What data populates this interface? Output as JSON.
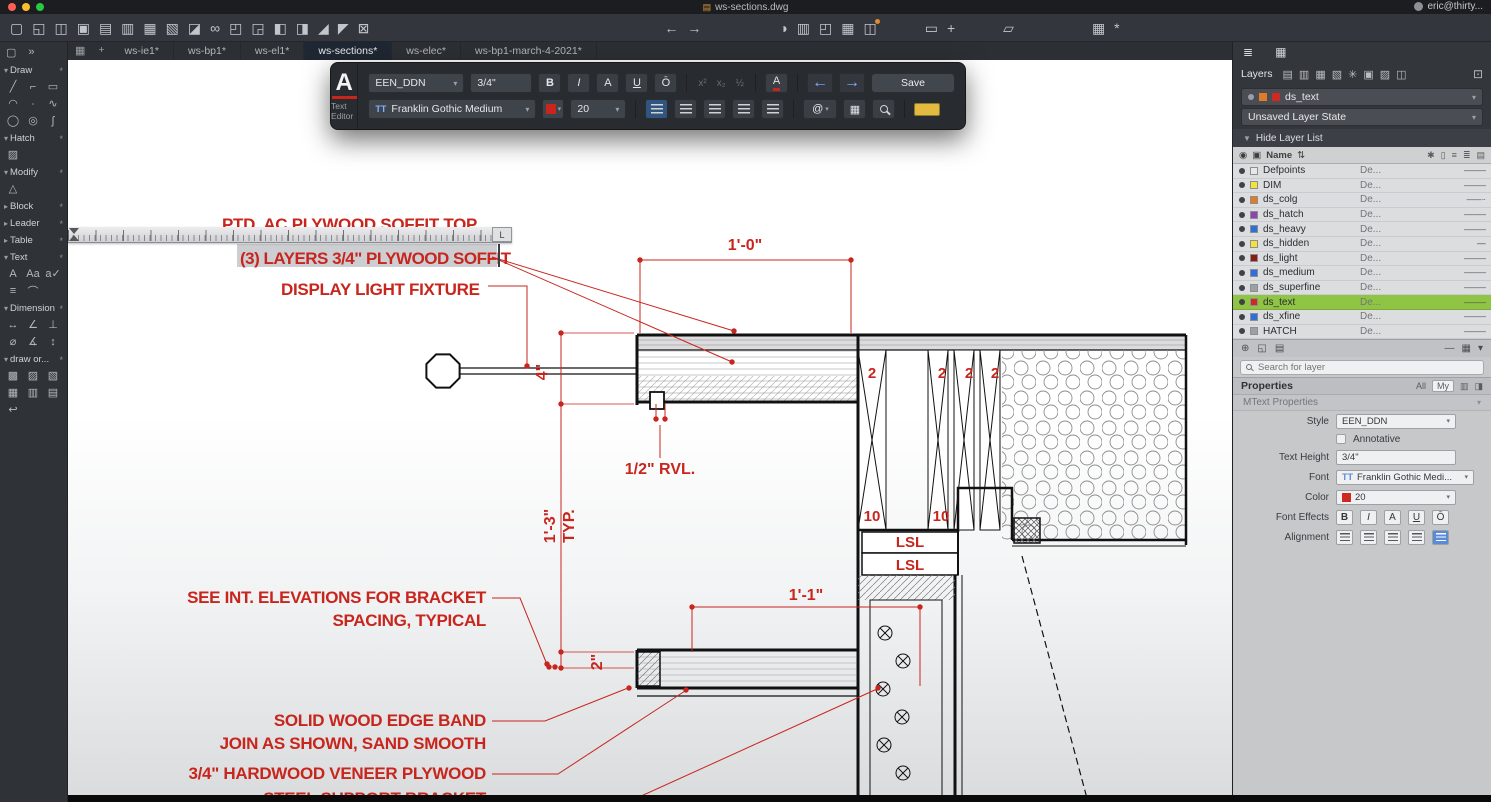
{
  "colors": {
    "annotation_red": "#c8251d",
    "selected_layer_green": "#8fc445",
    "accent_blue": "#5b8bd8"
  },
  "window": {
    "title": "ws-sections.dwg",
    "user": "eric@thirty...",
    "doc_icon": "▤"
  },
  "toolbar": {
    "left_icons": [
      {
        "name": "new-drawing-icon",
        "glyph": "▢"
      },
      {
        "name": "open-icon",
        "glyph": "◱"
      },
      {
        "name": "save-icon",
        "glyph": "◫"
      },
      {
        "name": "save-all-icon",
        "glyph": "▣"
      },
      {
        "name": "print-icon",
        "glyph": "▤"
      },
      {
        "name": "print-preview-icon",
        "glyph": "▥"
      },
      {
        "name": "publish-icon",
        "glyph": "▦"
      },
      {
        "name": "page-setup-icon",
        "glyph": "▧"
      },
      {
        "name": "eraser-icon",
        "glyph": "◪"
      },
      {
        "name": "link-icon",
        "glyph": "∞"
      },
      {
        "name": "import-icon",
        "glyph": "◰"
      },
      {
        "name": "export-icon",
        "glyph": "◲"
      },
      {
        "name": "clip-icon",
        "glyph": "◧"
      },
      {
        "name": "bound-icon",
        "glyph": "◨"
      },
      {
        "name": "scale-icon",
        "glyph": "◢"
      },
      {
        "name": "stretch-icon",
        "glyph": "◤"
      },
      {
        "name": "measure-icon",
        "glyph": "⊠"
      }
    ],
    "nav_icons": [
      {
        "name": "back-arrow-icon",
        "glyph": "←"
      },
      {
        "name": "forward-arrow-icon",
        "glyph": "→"
      }
    ],
    "right_icons": [
      {
        "name": "render-icon",
        "glyph": "◑"
      },
      {
        "name": "sheet-set-icon",
        "glyph": "▥"
      },
      {
        "name": "folder-icon",
        "glyph": "◰"
      },
      {
        "name": "palette-icon",
        "glyph": "▦"
      },
      {
        "name": "reference-manager-icon",
        "glyph": "◫",
        "badge": true
      }
    ],
    "far_icons": [
      {
        "name": "frame-icon",
        "glyph": "▭"
      },
      {
        "name": "pan-hand-icon",
        "glyph": "+"
      }
    ],
    "doc_icons": [
      {
        "name": "document-compare-icon",
        "glyph": "▱"
      }
    ],
    "end_icons": [
      {
        "name": "apps-grid-icon",
        "glyph": "▦"
      },
      {
        "name": "toolbar-settings-icon",
        "glyph": "*"
      }
    ]
  },
  "tabbar": {
    "grid_icon": "▦",
    "add_label": "+",
    "tabs": [
      {
        "label": "ws-ie1*",
        "active": false
      },
      {
        "label": "ws-bp1*",
        "active": false
      },
      {
        "label": "ws-el1*",
        "active": false
      },
      {
        "label": "ws-sections*",
        "active": true
      },
      {
        "label": "ws-elec*",
        "active": false
      },
      {
        "label": "ws-bp1-march-4-2021*",
        "active": false
      }
    ]
  },
  "sidebar": {
    "top_icons": [
      {
        "name": "selection-tool-icon",
        "glyph": "▢"
      },
      {
        "name": "more-panels-icon",
        "glyph": "»"
      }
    ],
    "sections": [
      {
        "label": "Draw",
        "arrow": "▾",
        "gear": "*",
        "items": [
          {
            "name": "line-tool-icon",
            "glyph": "╱"
          },
          {
            "name": "polyline-tool-icon",
            "glyph": "⌐"
          },
          {
            "name": "rectangle-tool-icon",
            "glyph": "▭"
          },
          {
            "name": "arc-tool-icon",
            "glyph": "◠"
          },
          {
            "name": "point-tool-icon",
            "glyph": "∙"
          },
          {
            "name": "freehand-tool-icon",
            "glyph": "∿"
          },
          {
            "name": "circle-tool-icon",
            "glyph": "◯"
          },
          {
            "name": "ellipse-tool-icon",
            "glyph": "◎"
          },
          {
            "name": "spline-tool-icon",
            "glyph": "ʃ"
          }
        ]
      },
      {
        "label": "Hatch",
        "arrow": "▾",
        "gear": "*",
        "items": [
          {
            "name": "hatch-tool-icon",
            "glyph": "▨"
          }
        ]
      },
      {
        "label": "Modify",
        "arrow": "▾",
        "gear": "*",
        "items": [
          {
            "name": "explode-tool-icon",
            "glyph": "△"
          }
        ]
      },
      {
        "label": "Block",
        "arrow": "▸",
        "gear": "*",
        "items": []
      },
      {
        "label": "Leader",
        "arrow": "▸",
        "gear": "*",
        "items": []
      },
      {
        "label": "Table",
        "arrow": "▸",
        "gear": "*",
        "items": []
      },
      {
        "label": "Text",
        "arrow": "▾",
        "gear": "*",
        "items": [
          {
            "name": "singleline-text-icon",
            "glyph": "A"
          },
          {
            "name": "multiline-text-icon",
            "glyph": "Aa"
          },
          {
            "name": "spellcheck-icon",
            "glyph": "a✓"
          },
          {
            "name": "text-align-icon",
            "glyph": "≡"
          },
          {
            "name": "arc-text-icon",
            "glyph": "⌒"
          }
        ]
      },
      {
        "label": "Dimension",
        "arrow": "▾",
        "gear": "*",
        "items": [
          {
            "name": "linear-dimension-icon",
            "glyph": "↔"
          },
          {
            "name": "aligned-dimension-icon",
            "glyph": "∠"
          },
          {
            "name": "ordinate-dimension-icon",
            "glyph": "⊥"
          },
          {
            "name": "radius-dimension-icon",
            "glyph": "⌀"
          },
          {
            "name": "angular-dimension-icon",
            "glyph": "∡"
          },
          {
            "name": "baseline-dimension-icon",
            "glyph": "↕"
          }
        ]
      },
      {
        "label": "draw or...",
        "arrow": "▾",
        "gear": "*",
        "items": [
          {
            "name": "draw-order-front-icon",
            "glyph": "▩"
          },
          {
            "name": "draw-order-back-icon",
            "glyph": "▨"
          },
          {
            "name": "draw-order-above-icon",
            "glyph": "▧"
          },
          {
            "name": "draw-order-below-icon",
            "glyph": "▦"
          },
          {
            "name": "draw-order-annotations-icon",
            "glyph": "▥"
          },
          {
            "name": "draw-order-hatch-icon",
            "glyph": "▤"
          },
          {
            "name": "undo-mark-icon",
            "glyph": "↩"
          }
        ]
      }
    ]
  },
  "canvas": {
    "ruler": {
      "tab": "L"
    },
    "ann": {
      "soffit_top": "PTD. AC PLYWOOD SOFFIT TOP",
      "soffit_layers": "(3) LAYERS 3/4\" PLYWOOD SOFFIT",
      "light_fixture": "DISPLAY LIGHT FIXTURE",
      "dim_1_0": "1'-0\"",
      "dim_4": "4\"",
      "rvl": "1/2\" RVL.",
      "dim_1_3": "1'-3\"",
      "typ": "TYP.",
      "dim_2": "2\"",
      "dim_1_1": "1'-1\"",
      "see_int_1": "SEE INT. ELEVATIONS FOR BRACKET",
      "see_int_2": "SPACING, TYPICAL",
      "solid_wood_1": "SOLID WOOD EDGE BAND",
      "solid_wood_2": "JOIN AS SHOWN, SAND SMOOTH",
      "hardwood": "3/4\" HARDWOOD VENEER PLYWOOD",
      "steel": "STEEL SUPPORT BRACKET",
      "lsl": "LSL",
      "stud": "2",
      "ten": "10"
    }
  },
  "text_editor": {
    "logo": "A",
    "label": "Text Editor",
    "style_value": "EEN_DDN",
    "height_value": "3/4\"",
    "bold": "B",
    "italic": "I",
    "caps": "A",
    "underline": "U",
    "overline": "Ō",
    "superscript": "x²",
    "subscript": "x₂",
    "stack": "½",
    "color_a": "A",
    "undo": "←",
    "redo": "→",
    "save": "Save",
    "font_prefix": "TT",
    "font_value": "Franklin Gothic Medium",
    "size_value": "20",
    "at": "@",
    "columns_icon": "▦",
    "chip_color": "#c8251d"
  },
  "layers_panel": {
    "tab_icons": [
      {
        "name": "layers-tab-icon",
        "glyph": "≣"
      },
      {
        "name": "images-tab-icon",
        "glyph": "▦"
      }
    ],
    "title": "Layers",
    "toolbar_icons": [
      {
        "name": "new-layer-icon",
        "glyph": "▤"
      },
      {
        "name": "delete-layer-icon",
        "glyph": "▥"
      },
      {
        "name": "layer-states-icon",
        "glyph": "▦"
      },
      {
        "name": "isolate-layer-icon",
        "glyph": "▧"
      },
      {
        "name": "freeze-layer-icon",
        "glyph": "✳"
      },
      {
        "name": "lock-layer-icon",
        "glyph": "▣"
      },
      {
        "name": "layer-color-icon",
        "glyph": "▨"
      },
      {
        "name": "layer-walk-icon",
        "glyph": "◫"
      }
    ],
    "corner_icon": "⊡",
    "current_layer": {
      "name": "ds_text",
      "chip1": "#e07b28",
      "chip2": "#cf2a21"
    },
    "layer_state": "Unsaved Layer State",
    "hide_list": "Hide Layer List",
    "header": {
      "eye": "◉",
      "chip": "▣",
      "name": "Name",
      "sort": "⇅",
      "col1": "✱",
      "col2": "▯",
      "col3": "≡",
      "col4": "≣",
      "col5": "▤"
    },
    "rows": [
      {
        "name": "Defpoints",
        "color": "#e8e8e8",
        "desc": "De...",
        "line": "———"
      },
      {
        "name": "DIM",
        "color": "#f2e23a",
        "desc": "De...",
        "line": "———"
      },
      {
        "name": "ds_colg",
        "color": "#e07b28",
        "desc": "De...",
        "line": "—— ··"
      },
      {
        "name": "ds_hatch",
        "color": "#8e44ad",
        "desc": "De...",
        "line": "———"
      },
      {
        "name": "ds_heavy",
        "color": "#2e6fd8",
        "desc": "De...",
        "line": "———"
      },
      {
        "name": "ds_hidden",
        "color": "#f2e23a",
        "desc": "De...",
        "line": "-----"
      },
      {
        "name": "ds_light",
        "color": "#8b1a12",
        "desc": "De...",
        "line": "———"
      },
      {
        "name": "ds_medium",
        "color": "#2e6fd8",
        "desc": "De...",
        "line": "———"
      },
      {
        "name": "ds_superfine",
        "color": "#9aa0a6",
        "desc": "De...",
        "line": "———"
      },
      {
        "name": "ds_text",
        "color": "#cf2a21",
        "desc": "De...",
        "line": "———",
        "selected": true
      },
      {
        "name": "ds_xfine",
        "color": "#2e6fd8",
        "desc": "De...",
        "line": "———"
      },
      {
        "name": "HATCH",
        "color": "#9aa0a6",
        "desc": "De...",
        "line": "———"
      }
    ],
    "footer_icons": [
      {
        "name": "isolate-footer-icon",
        "glyph": "⊕"
      },
      {
        "name": "group-footer-icon",
        "glyph": "◱"
      },
      {
        "name": "settings-footer-icon",
        "glyph": "▤"
      }
    ],
    "footer_right": {
      "minus": "—",
      "columns": "▦",
      "caret": "▾"
    },
    "search_placeholder": "Search for layer"
  },
  "properties_panel": {
    "title": "Properties",
    "all": "All",
    "my": "My",
    "head_icon1": "▥",
    "head_icon2": "◨",
    "subtitle": "MText Properties",
    "style_label": "Style",
    "style_value": "EEN_DDN",
    "annotative_label": "Annotative",
    "height_label": "Text Height",
    "height_value": "3/4\"",
    "font_label": "Font",
    "font_prefix": "TT",
    "font_value": "Franklin Gothic Medi...",
    "color_label": "Color",
    "color_value": "20",
    "color_chip": "#cf2a21",
    "effects_label": "Font Effects",
    "fx_b": "B",
    "fx_i": "I",
    "fx_a": "A",
    "fx_u": "U",
    "fx_o": "Ō",
    "alignment_label": "Alignment"
  }
}
